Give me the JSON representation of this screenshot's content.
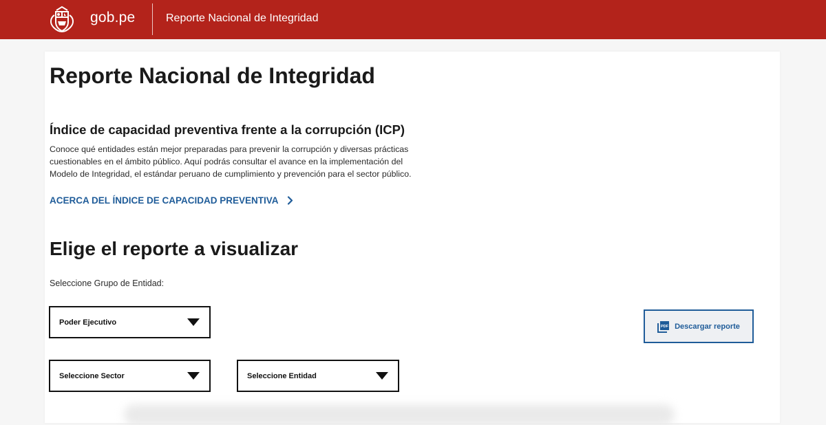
{
  "header": {
    "logo_text": "gob.pe",
    "title": "Reporte Nacional de Integridad",
    "background_color": "#b3231b",
    "crest_icon": "peru-coat-of-arms-icon"
  },
  "main": {
    "page_title": "Reporte Nacional de Integridad",
    "section_title": "Índice de capacidad preventiva frente a la corrupción (ICP)",
    "description": "Conoce qué entidades están mejor preparadas para prevenir la corrupción y diversas prácticas cuestionables en el ámbito público. Aquí podrás consultar el avance en la implementación del Modelo de Integridad, el estándar peruano de cumplimiento y prevención para el sector público.",
    "about_link": {
      "label": "ACERCA DEL ÍNDICE DE CAPACIDAD PREVENTIVA",
      "icon": "chevron-right-icon",
      "color": "#1f5c99"
    },
    "choose_title": "Elige el reporte a visualizar",
    "group_label": "Seleccione Grupo de Entidad:",
    "selects": {
      "group": "Poder Ejecutivo",
      "sector": "Seleccione Sector",
      "entity": "Seleccione Entidad"
    },
    "download_button": {
      "label": "Descargar reporte",
      "icon": "pdf-icon"
    }
  }
}
